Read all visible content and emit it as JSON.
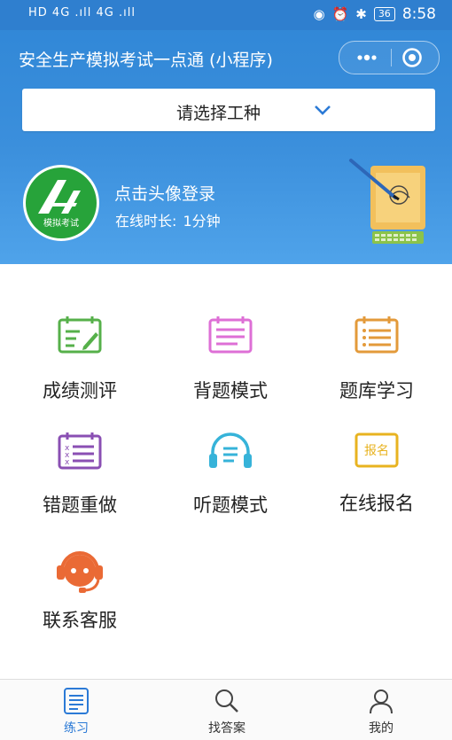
{
  "status_bar": {
    "left": "HD 4G .ıll 4G .ıll",
    "battery": "36",
    "time": "8:58"
  },
  "header": {
    "title": "安全生产模拟考试一点通 (小程序)",
    "more_icon": "more-dots-icon",
    "close_icon": "target-circle-icon"
  },
  "selector": {
    "label": "请选择工种"
  },
  "profile": {
    "avatar_text": "模拟考试",
    "login_prompt": "点击头像登录",
    "online_label": "在线时长:",
    "online_value": "1分钟"
  },
  "menu": [
    {
      "label": "成绩测评",
      "icon": "scorecard-icon",
      "color": "#56b04a"
    },
    {
      "label": "背题模式",
      "icon": "notes-icon",
      "color": "#de6fd6"
    },
    {
      "label": "题库学习",
      "icon": "list-book-icon",
      "color": "#e39a3a"
    },
    {
      "label": "错题重做",
      "icon": "wrong-list-icon",
      "color": "#8a4fb3"
    },
    {
      "label": "听题模式",
      "icon": "headphones-icon",
      "color": "#36b3d9"
    },
    {
      "label": "在线报名",
      "icon": "register-icon",
      "color": "#e8b320"
    },
    {
      "label": "联系客服",
      "icon": "customer-service-icon",
      "color": "#ea6a35"
    }
  ],
  "registration_tag": "报名",
  "tabs": [
    {
      "label": "练习",
      "icon": "practice-icon",
      "active": true
    },
    {
      "label": "找答案",
      "icon": "search-icon",
      "active": false
    },
    {
      "label": "我的",
      "icon": "user-icon",
      "active": false
    }
  ],
  "colors": {
    "header_blue": "#2f86d6",
    "active_tab": "#2b7ad6"
  }
}
